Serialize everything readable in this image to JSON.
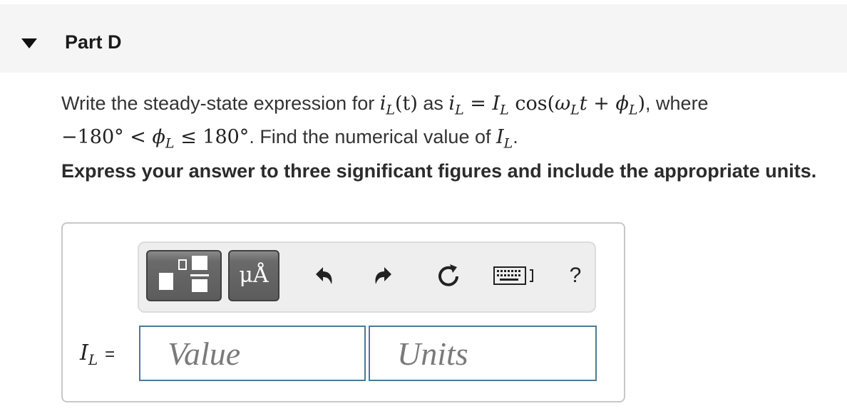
{
  "part": {
    "title": "Part D"
  },
  "question": {
    "t1": "Write the steady-state expression for ",
    "iL_i": "i",
    "iL_sub": "L",
    "t_arg": "(t)",
    "t2": " as ",
    "iL2_i": "i",
    "iL2_sub": "L",
    "eq": " = ",
    "IL_I": "I",
    "IL_sub": "L",
    "cos": " cos(",
    "w": "ω",
    "w_sub": "L",
    "t": "t",
    "plus": " + ",
    "phi": "ϕ",
    "phi_sub": "L",
    "close": ")",
    "t3": ", where",
    "range_a": "−180° < ",
    "phi2": "ϕ",
    "phi2_sub": "L",
    "range_b": " ≤ 180°",
    "t4": ". Find the numerical value of ",
    "IL2_I": "I",
    "IL2_sub": "L",
    "t5": "."
  },
  "instructions": "Express your answer to three significant figures and include the appropriate units.",
  "toolbar": {
    "units_label": "μÅ",
    "undo_icon": "undo-icon",
    "redo_icon": "redo-icon",
    "reset_icon": "reset-icon",
    "keyboard_icon": "keyboard-icon",
    "help_label": "?"
  },
  "answer": {
    "label_I": "I",
    "label_sub": "L",
    "label_eq": "=",
    "value_placeholder": "Value",
    "units_placeholder": "Units"
  }
}
